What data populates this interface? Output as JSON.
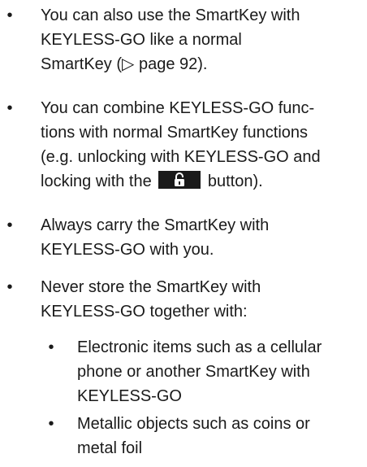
{
  "bullet_glyph": "•",
  "items": [
    {
      "lines": [
        "You can also use the SmartKey with",
        "KEYLESS-GO like a normal",
        "SmartKey (▷ page 92)."
      ]
    },
    {
      "lines": [
        "You can combine KEYLESS-GO func-",
        "tions with normal SmartKey functions",
        "(e.g. unlocking with KEYLESS-GO and"
      ],
      "last_line_before_icon": "locking with the",
      "last_line_after_icon": "button)."
    },
    {
      "lines": [
        "Always carry the SmartKey with",
        "KEYLESS-GO with you."
      ]
    },
    {
      "lines": [
        "Never store the SmartKey with",
        "KEYLESS-GO together with:"
      ]
    }
  ],
  "subitems": [
    {
      "lines": [
        "Electronic items such as a cellular",
        "phone or another SmartKey with",
        "KEYLESS-GO"
      ]
    },
    {
      "lines": [
        "Metallic objects such as coins or",
        "metal foil"
      ]
    }
  ],
  "icons": {
    "lock_button": "lock-icon"
  }
}
